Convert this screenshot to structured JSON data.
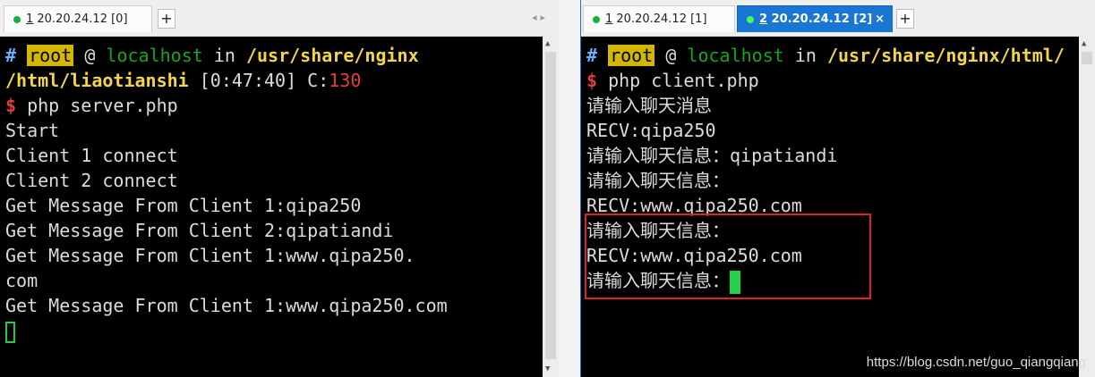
{
  "left": {
    "tab": {
      "number": "1",
      "title": " 20.20.24.12 [0]"
    },
    "plus": "+",
    "prompt": {
      "hash": "#",
      "user": "root",
      "at": "@",
      "host": "localhost",
      "in": "in",
      "path1": "/usr/share/nginx",
      "path2": "/html/liaotianshi",
      "time": "[0:47:40]",
      "c_label": "C:",
      "c_code": "130"
    },
    "cmd": {
      "dollar": "$",
      "text": "php server.php"
    },
    "output": [
      "Start",
      "Client 1 connect",
      "Client 2 connect",
      "Get Message From Client 1:qipa250",
      "Get Message From Client 2:qipatiandi",
      "Get Message From Client 1:www.qipa250.",
      "com",
      "Get Message From Client 1:www.qipa250.com"
    ]
  },
  "right": {
    "tabs": [
      {
        "number": "1",
        "title": " 20.20.24.12 [1]"
      },
      {
        "number": "2",
        "title": " 20.20.24.12 [2]"
      }
    ],
    "close": "×",
    "plus": "+",
    "prompt": {
      "hash": "#",
      "user": "root",
      "at": "@",
      "host": "localhost",
      "in": "in",
      "path": "/usr/share/nginx/html/"
    },
    "cmd": {
      "dollar": "$",
      "text": "php client.php"
    },
    "output": [
      "请输入聊天消息",
      "RECV:qipa250",
      "请输入聊天信息：qipatiandi",
      "请输入聊天信息：",
      "RECV:www.qipa250.com",
      "请输入聊天信息：",
      "RECV:www.qipa250.com",
      "请输入聊天信息："
    ]
  },
  "watermark": "https://blog.csdn.net/guo_qiangqiang"
}
